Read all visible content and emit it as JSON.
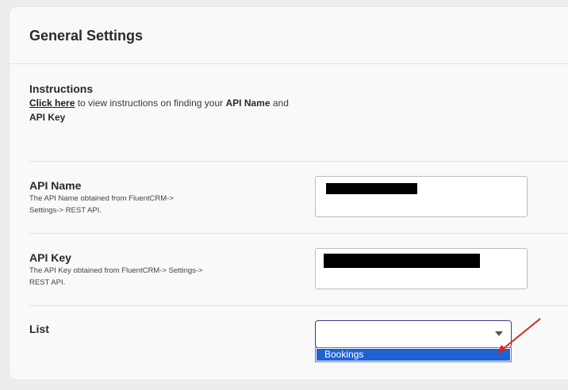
{
  "page": {
    "title": "General Settings"
  },
  "instructions": {
    "label": "Instructions",
    "link_text": "Click here",
    "text_before_bold": " to view instructions on finding your ",
    "bold_1": "API Name",
    "text_middle": " and",
    "bold_2": "API Key"
  },
  "api_name": {
    "label": "API Name",
    "help_line_1": "The API Name obtained from FluentCRM->",
    "help_line_2": "Settings-> REST API.",
    "value": "[redacted]"
  },
  "api_key": {
    "label": "API Key",
    "help_line_1": "The API Key obtained from FluentCRM-> Settings->",
    "help_line_2": "REST API.",
    "value": "[redacted]"
  },
  "list": {
    "label": "List",
    "selected_value": "",
    "options": [
      "Bookings"
    ],
    "highlighted_option": "Bookings"
  },
  "colors": {
    "accent": "#1f63d2",
    "annotation_arrow": "#e02020",
    "select_border": "#3c3c8a"
  }
}
